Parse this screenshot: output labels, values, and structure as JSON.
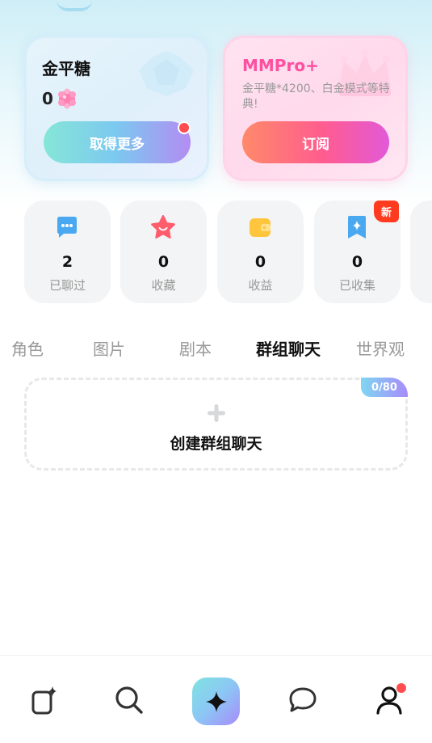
{
  "gold_card": {
    "title": "金平糖",
    "balance": "0",
    "button_label": "取得更多"
  },
  "pro_card": {
    "title": "MMPro+",
    "description": "金平糖*4200、白金模式等特典!",
    "button_label": "订阅"
  },
  "stats": [
    {
      "icon": "chat-bubble-icon",
      "value": "2",
      "label": "已聊过",
      "color": "#4aa8f0"
    },
    {
      "icon": "star-icon",
      "value": "0",
      "label": "收藏",
      "color": "#ff5c6c"
    },
    {
      "icon": "wallet-icon",
      "value": "0",
      "label": "收益",
      "color": "#ffc53d"
    },
    {
      "icon": "bookmark-sparkle-icon",
      "value": "0",
      "label": "已收集",
      "color": "#4aa8f0"
    }
  ],
  "new_badge": "新",
  "tabs": [
    "角色",
    "图片",
    "剧本",
    "群组聊天",
    "世界观"
  ],
  "active_tab": "群组聊天",
  "create_group": {
    "count": "0/80",
    "label": "创建群组聊天"
  },
  "bottom_nav": [
    {
      "icon": "create-card-icon"
    },
    {
      "icon": "search-icon"
    },
    {
      "icon": "sparkle-icon"
    },
    {
      "icon": "message-icon"
    },
    {
      "icon": "profile-icon"
    }
  ],
  "colors": {
    "pro_accent": "#ff4fa0",
    "badge_red": "#ff3b1f",
    "notification_dot": "#ff4d4f"
  }
}
